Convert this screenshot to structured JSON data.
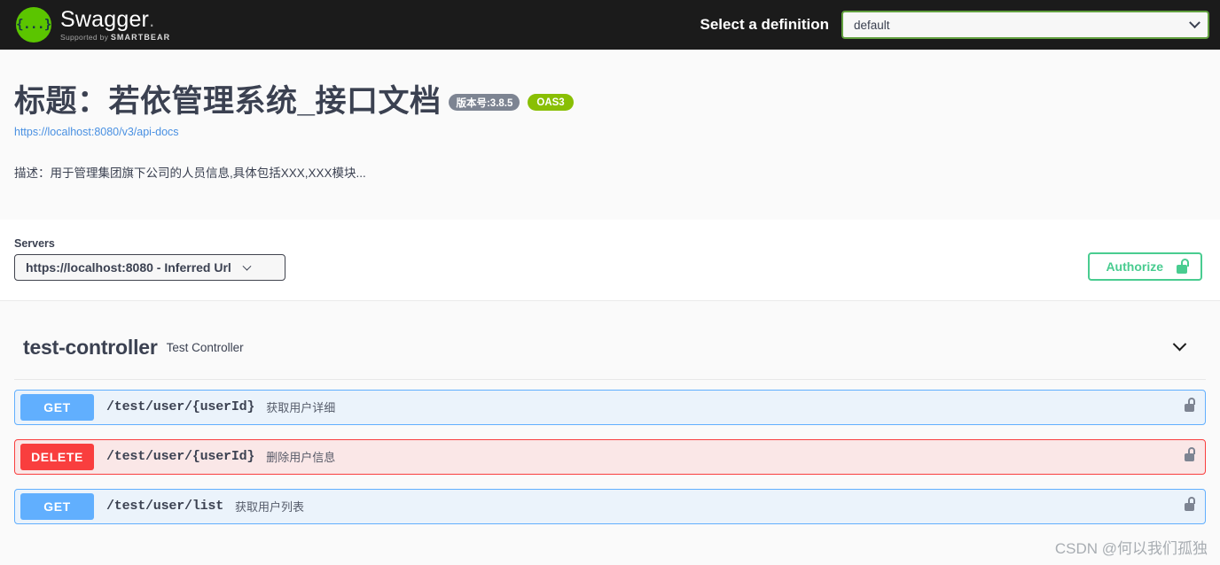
{
  "topbar": {
    "logo_glyph": "{...}",
    "brand_name": "Swagger",
    "brand_dot": ".",
    "brand_sub_prefix": "Supported by ",
    "brand_sub_name": "SMARTBEAR",
    "definition_label": "Select a definition",
    "definition_value": "default",
    "definition_options": [
      "default"
    ]
  },
  "info": {
    "title": "标题：若依管理系统_接口文档",
    "version_badge": "版本号:3.8.5",
    "spec_badge": "OAS3",
    "url": "https://localhost:8080/v3/api-docs",
    "description": "描述：用于管理集团旗下公司的人员信息,具体包括XXX,XXX模块..."
  },
  "servers": {
    "label": "Servers",
    "selected": "https://localhost:8080 - Inferred Url",
    "options": [
      "https://localhost:8080 - Inferred Url"
    ],
    "authorize_label": "Authorize"
  },
  "tag": {
    "name": "test-controller",
    "description": "Test Controller"
  },
  "operations": [
    {
      "method": "GET",
      "style": "get",
      "path": "/test/user/{userId}",
      "summary": "获取用户详细"
    },
    {
      "method": "DELETE",
      "style": "delete",
      "path": "/test/user/{userId}",
      "summary": "删除用户信息"
    },
    {
      "method": "GET",
      "style": "get",
      "path": "/test/user/list",
      "summary": "获取用户列表"
    }
  ],
  "watermark": "CSDN @何以我们孤独",
  "colors": {
    "topbar_bg": "#1b1b1b",
    "brand_green": "#5bc500",
    "oas_green": "#89bf04",
    "version_gray": "#7d8492",
    "authorize_green": "#49cc90",
    "get_blue": "#61affe",
    "delete_red": "#f93e3e",
    "link_blue": "#4990e2",
    "text": "#3b4151"
  }
}
